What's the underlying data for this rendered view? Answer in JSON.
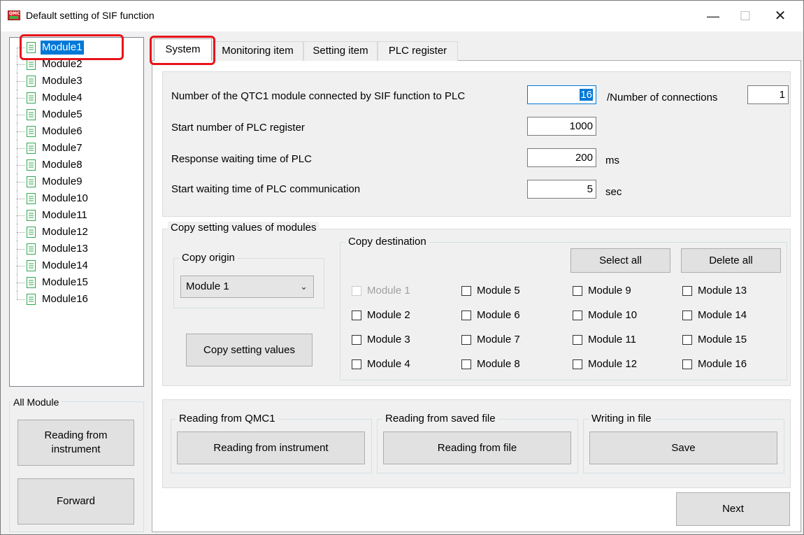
{
  "window": {
    "title": "Default setting of SIF function",
    "icon_text": "QMC1",
    "controls": {
      "minimize": "—",
      "maximize": "☐",
      "close": "✕"
    }
  },
  "tree": {
    "items": [
      {
        "label": "Module1"
      },
      {
        "label": "Module2"
      },
      {
        "label": "Module3"
      },
      {
        "label": "Module4"
      },
      {
        "label": "Module5"
      },
      {
        "label": "Module6"
      },
      {
        "label": "Module7"
      },
      {
        "label": "Module8"
      },
      {
        "label": "Module9"
      },
      {
        "label": "Module10"
      },
      {
        "label": "Module11"
      },
      {
        "label": "Module12"
      },
      {
        "label": "Module13"
      },
      {
        "label": "Module14"
      },
      {
        "label": "Module15"
      },
      {
        "label": "Module16"
      }
    ],
    "selected": "Module1"
  },
  "all_module": {
    "title": "All Module",
    "read_button": "Reading from instrument",
    "forward_button": "Forward"
  },
  "tabs": [
    {
      "label": "System"
    },
    {
      "label": "Monitoring item"
    },
    {
      "label": "Setting item"
    },
    {
      "label": "PLC register"
    }
  ],
  "system": {
    "num_modules_label": "Number of the QTC1 module connected by SIF function to PLC",
    "num_modules_value": "16",
    "num_connections_label": "/Number of connections",
    "num_connections_value": "1",
    "start_register_label": "Start number of PLC register",
    "start_register_value": "1000",
    "response_wait_label": "Response waiting time of PLC",
    "response_wait_value": "200",
    "response_wait_unit": "ms",
    "start_wait_label": "Start waiting time of PLC communication",
    "start_wait_value": "5",
    "start_wait_unit": "sec"
  },
  "copy": {
    "title": "Copy setting values of modules",
    "origin_title": "Copy origin",
    "origin_value": "Module 1",
    "copy_button": "Copy setting values",
    "dest_title": "Copy destination",
    "select_all": "Select all",
    "delete_all": "Delete all",
    "modules": [
      "Module 1",
      "Module 2",
      "Module 3",
      "Module 4",
      "Module 5",
      "Module 6",
      "Module 7",
      "Module 8",
      "Module 9",
      "Module 10",
      "Module 11",
      "Module 12",
      "Module 13",
      "Module 14",
      "Module 15",
      "Module 16"
    ]
  },
  "reading": {
    "qmc1_title": "Reading from QMC1",
    "qmc1_button": "Reading from instrument",
    "file_title": "Reading from saved file",
    "file_button": "Reading from file",
    "write_title": "Writing in file",
    "write_button": "Save"
  },
  "next_button": "Next",
  "colors": {
    "selection": "#0078d7",
    "highlight_box": "#e8141a",
    "doc_icon": "#2fa84f"
  }
}
